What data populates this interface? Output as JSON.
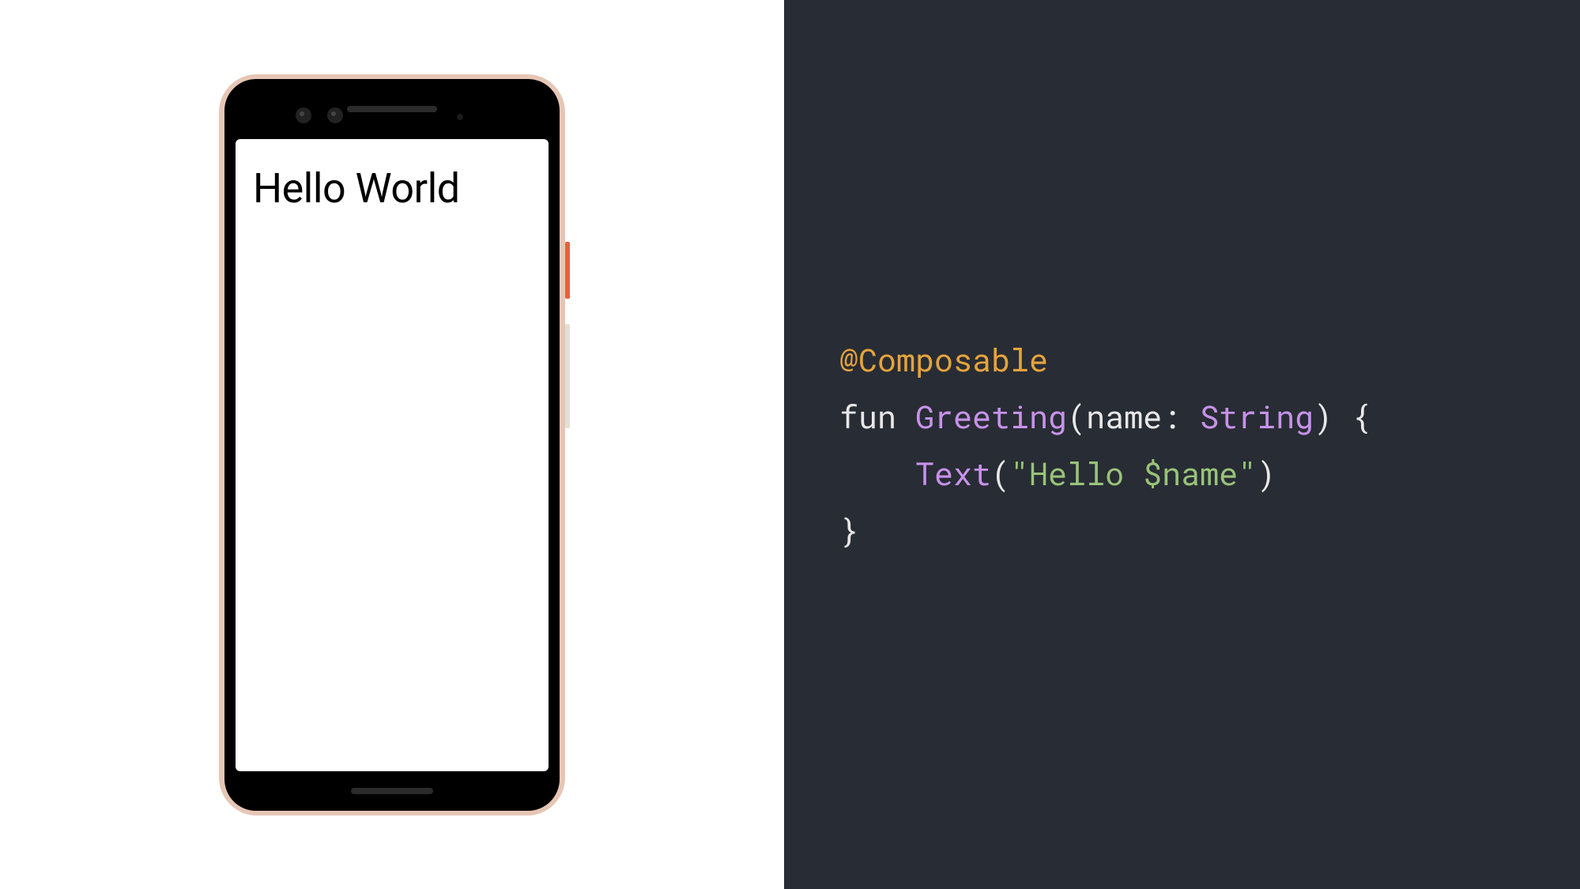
{
  "phone": {
    "screen_text": "Hello World"
  },
  "code": {
    "annotation": "@Composable",
    "kw_fun": "fun",
    "func_name": "Greeting",
    "paren_open": "(",
    "param_name": "name",
    "colon": ":",
    "param_type": "String",
    "paren_close": ")",
    "brace_open": "{",
    "indent": "    ",
    "call_name": "Text",
    "call_open": "(",
    "string_literal": "\"Hello $name\"",
    "call_close": ")",
    "brace_close": "}"
  }
}
